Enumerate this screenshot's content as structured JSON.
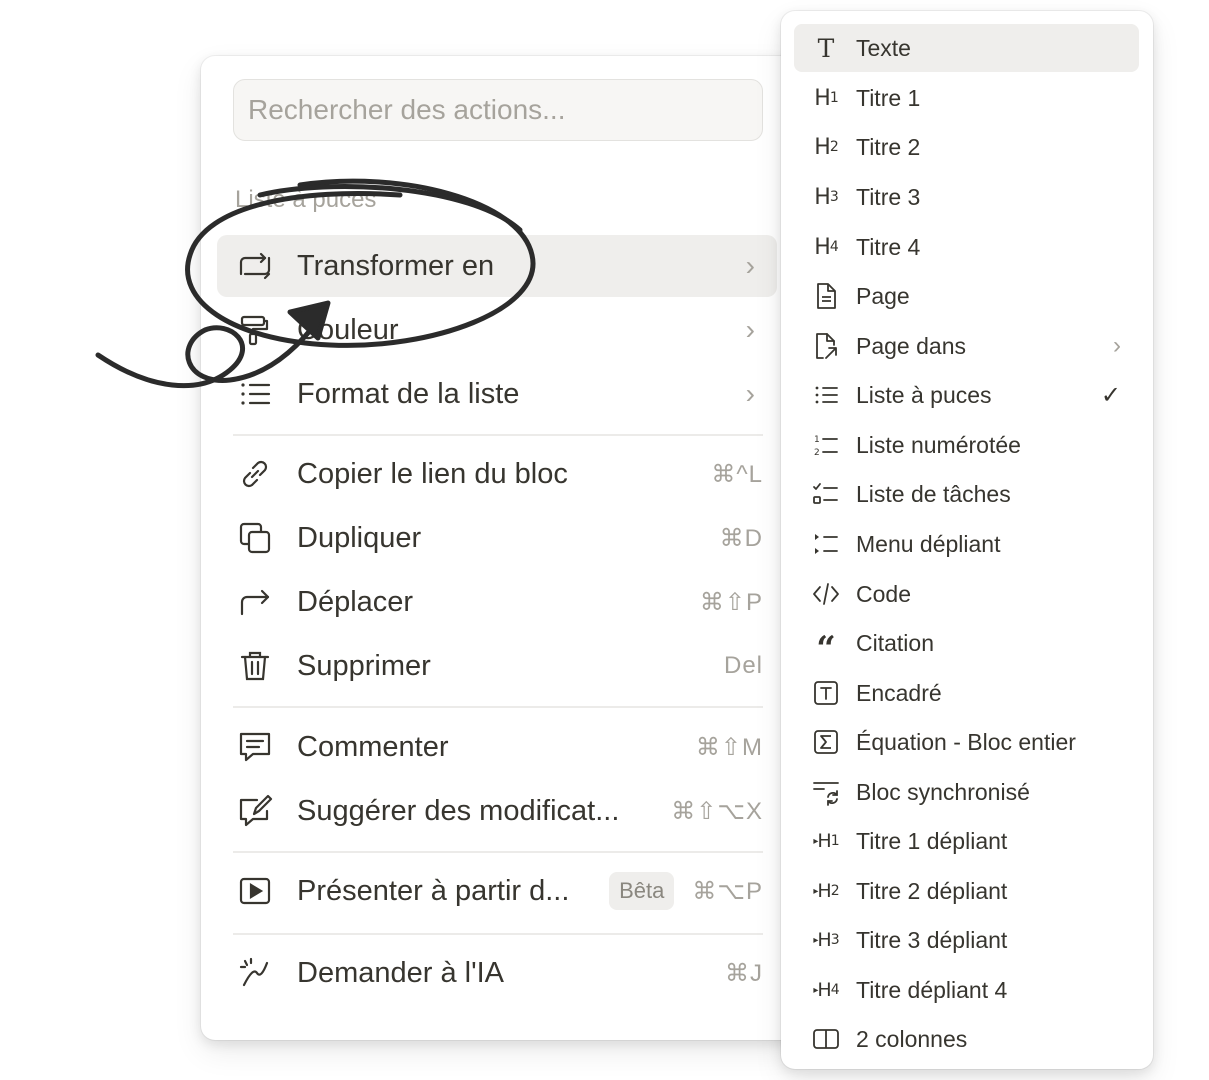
{
  "main_menu": {
    "search_placeholder": "Rechercher des actions...",
    "section_label": "Liste à puces",
    "items": [
      {
        "label": "Transformer en",
        "chevron": "›",
        "icon": "transform-icon"
      },
      {
        "label": "Couleur",
        "chevron": "›",
        "icon": "paint-roller-icon"
      },
      {
        "label": "Format de la liste",
        "chevron": "›",
        "icon": "list-icon"
      },
      {
        "label": "Copier le lien du bloc",
        "shortcut": "⌘^L",
        "icon": "link-icon"
      },
      {
        "label": "Dupliquer",
        "shortcut": "⌘D",
        "icon": "duplicate-icon"
      },
      {
        "label": "Déplacer",
        "shortcut": "⌘⇧P",
        "icon": "move-arrow-icon"
      },
      {
        "label": "Supprimer",
        "shortcut": "Del",
        "icon": "trash-icon"
      },
      {
        "label": "Commenter",
        "shortcut": "⌘⇧M",
        "icon": "comment-icon"
      },
      {
        "label": "Suggérer des modificat...",
        "shortcut": "⌘⇧⌥X",
        "icon": "suggest-edit-icon"
      },
      {
        "label": "Présenter à partir d...",
        "badge": "Bêta",
        "shortcut": "⌘⌥P",
        "icon": "present-icon"
      },
      {
        "label": "Demander à l'IA",
        "shortcut": "⌘J",
        "icon": "ai-icon"
      }
    ]
  },
  "submenu": {
    "items": [
      {
        "label": "Texte",
        "icon": "text-icon"
      },
      {
        "label": "Titre 1",
        "icon": "heading-1-icon"
      },
      {
        "label": "Titre 2",
        "icon": "heading-2-icon"
      },
      {
        "label": "Titre 3",
        "icon": "heading-3-icon"
      },
      {
        "label": "Titre 4",
        "icon": "heading-4-icon"
      },
      {
        "label": "Page",
        "icon": "page-icon"
      },
      {
        "label": "Page dans",
        "chevron": "›",
        "icon": "page-link-icon"
      },
      {
        "label": "Liste à puces",
        "check": "✓",
        "icon": "bulleted-list-icon"
      },
      {
        "label": "Liste numérotée",
        "icon": "numbered-list-icon"
      },
      {
        "label": "Liste de tâches",
        "icon": "todo-list-icon"
      },
      {
        "label": "Menu dépliant",
        "icon": "toggle-list-icon"
      },
      {
        "label": "Code",
        "icon": "code-icon"
      },
      {
        "label": "Citation",
        "icon": "quote-icon"
      },
      {
        "label": "Encadré",
        "icon": "callout-icon"
      },
      {
        "label": "Équation - Bloc entier",
        "icon": "equation-icon"
      },
      {
        "label": "Bloc synchronisé",
        "icon": "synced-block-icon"
      },
      {
        "label": "Titre 1 dépliant",
        "icon": "toggle-heading-1-icon"
      },
      {
        "label": "Titre 2 dépliant",
        "icon": "toggle-heading-2-icon"
      },
      {
        "label": "Titre 3 dépliant",
        "icon": "toggle-heading-3-icon"
      },
      {
        "label": "Titre dépliant 4",
        "icon": "toggle-heading-4-icon"
      },
      {
        "label": "2 colonnes",
        "icon": "columns-icon"
      }
    ]
  }
}
